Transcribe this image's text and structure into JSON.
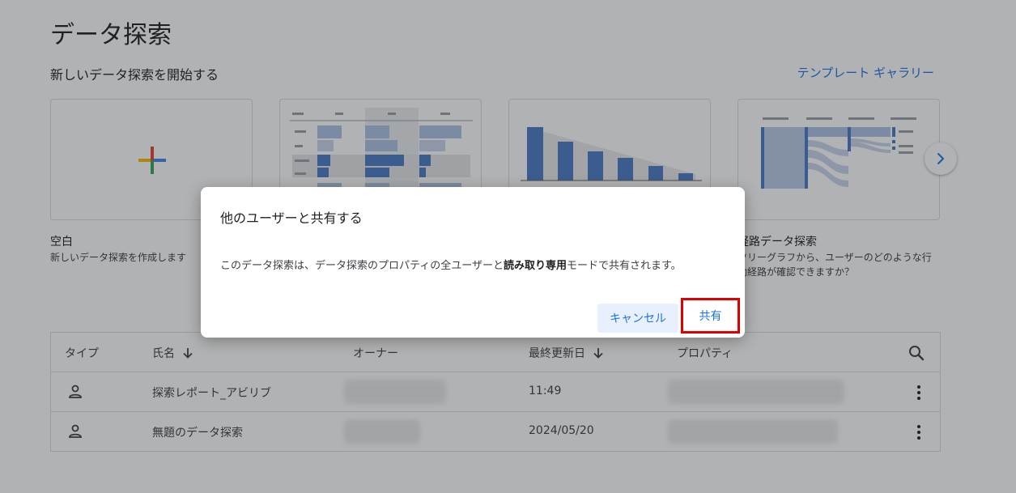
{
  "page": {
    "title": "データ探索",
    "section_title": "新しいデータ探索を開始する",
    "gallery_link": "テンプレート ギャラリー"
  },
  "templates": [
    {
      "label": "空白",
      "description": "新しいデータ探索を作成します"
    },
    {
      "label": "",
      "description": ""
    },
    {
      "label": "",
      "description": ""
    },
    {
      "label": "経路データ探索",
      "description_line1": "ツリーグラフから、ユーザーのどのような行",
      "description_line2": "動経路が確認できますか？"
    }
  ],
  "table": {
    "headers": {
      "type": "タイプ",
      "name": "氏名",
      "owner": "オーナー",
      "updated": "最終更新日",
      "property": "プロパティ"
    },
    "rows": [
      {
        "name": "探索レポート_アビリブ",
        "updated": "11:49"
      },
      {
        "name": "無題のデータ探索",
        "updated": "2024/05/20"
      }
    ]
  },
  "dialog": {
    "title": "他のユーザーと共有する",
    "body_prefix": "このデータ探索は、データ探索のプロパティの全ユーザーと",
    "body_bold": "読み取り専用",
    "body_suffix": "モードで共有されます。",
    "cancel_label": "キャンセル",
    "share_label": "共有"
  },
  "colors": {
    "accent": "#1a73e8",
    "highlight_border": "#e00000",
    "chart_blue": "#4a7cc7"
  }
}
